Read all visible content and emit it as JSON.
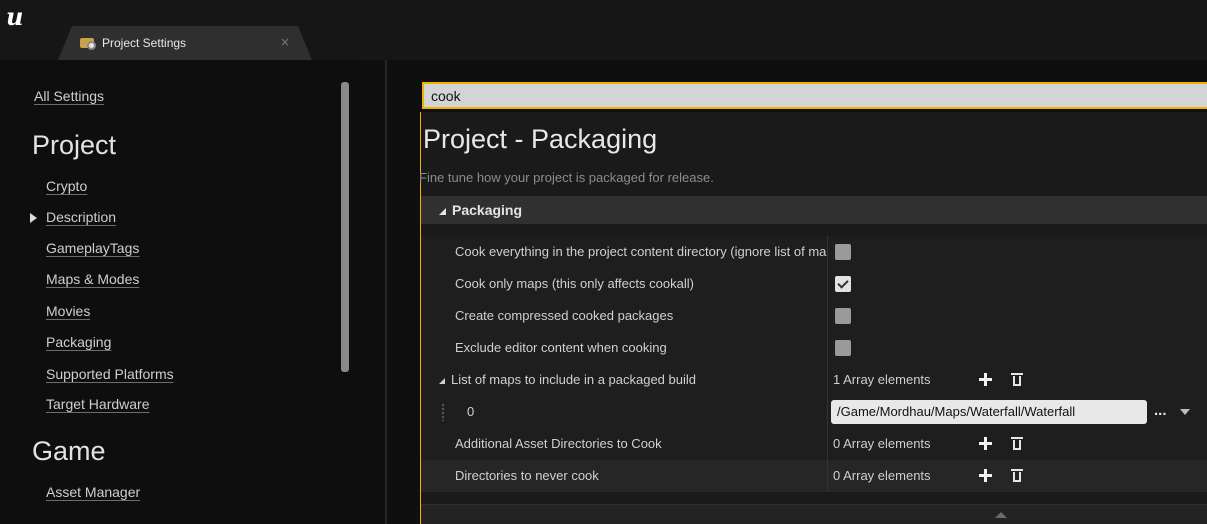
{
  "app": {
    "logo_text": "u"
  },
  "tab": {
    "label": "Project Settings",
    "close_glyph": "×"
  },
  "sidebar": {
    "all_settings": "All Settings",
    "sections": [
      {
        "header": "Project",
        "items": [
          "Crypto",
          "Description",
          "GameplayTags",
          "Maps & Modes",
          "Movies",
          "Packaging",
          "Supported Platforms",
          "Target Hardware"
        ]
      },
      {
        "header": "Game",
        "items": [
          "Asset Manager"
        ]
      }
    ]
  },
  "search": {
    "value": "cook"
  },
  "panel": {
    "title": "Project - Packaging",
    "subtitle": "Fine tune how your project is packaged for release.",
    "category": "Packaging",
    "rows": [
      {
        "name": "Cook everything in the project content directory (ignore list of maps below)",
        "checked": false
      },
      {
        "name": "Cook only maps (this only affects cookall)",
        "checked": true
      },
      {
        "name": "Create compressed cooked packages",
        "checked": false
      },
      {
        "name": "Exclude editor content when cooking",
        "checked": false
      }
    ],
    "maps_list": {
      "name": "List of maps to include in a packaged build",
      "count_text": "1 Array elements",
      "element": {
        "index": "0",
        "value": "/Game/Mordhau/Maps/Waterfall/Waterfall",
        "browse": "..."
      }
    },
    "asset_dirs": {
      "name": "Additional Asset Directories to Cook",
      "count_text": "0 Array elements"
    },
    "never_cook": {
      "name": "Directories to never cook",
      "count_text": "0 Array elements"
    }
  },
  "colors": {
    "accent": "#f0b400",
    "background": "#1a1a1a"
  },
  "icons": [
    "unreal-logo-icon",
    "project-settings-icon",
    "close-icon",
    "expand-arrow-icon",
    "plus-icon",
    "trash-icon",
    "chevron-down-icon",
    "drag-handle-icon"
  ]
}
